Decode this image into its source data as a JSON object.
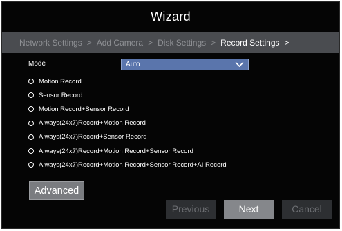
{
  "window": {
    "title": "Wizard"
  },
  "steps": [
    {
      "label": "Network Settings",
      "active": false
    },
    {
      "label": "Add Camera",
      "active": false
    },
    {
      "label": "Disk Settings",
      "active": false
    },
    {
      "label": "Record Settings",
      "active": true
    }
  ],
  "step_separator": ">",
  "mode": {
    "label": "Mode",
    "value": "Auto"
  },
  "options": [
    {
      "label": "Motion Record"
    },
    {
      "label": "Sensor Record"
    },
    {
      "label": "Motion Record+Sensor Record"
    },
    {
      "label": "Always(24x7)Record+Motion Record"
    },
    {
      "label": "Always(24x7)Record+Sensor Record"
    },
    {
      "label": "Always(24x7)Record+Motion Record+Sensor Record"
    },
    {
      "label": "Always(24x7)Record+Motion  Record+Sensor Record+AI  Record"
    }
  ],
  "buttons": {
    "advanced": "Advanced",
    "previous": "Previous",
    "next": "Next",
    "cancel": "Cancel"
  },
  "colors": {
    "background": "#050505",
    "steps_bar": "#4a4c50",
    "select_fill": "#5a75ac",
    "active_text": "#ffffff",
    "inactive_text": "#8e9094"
  },
  "icons": {
    "dropdown": "chevron-down-icon",
    "option": "radio-circle-icon"
  }
}
